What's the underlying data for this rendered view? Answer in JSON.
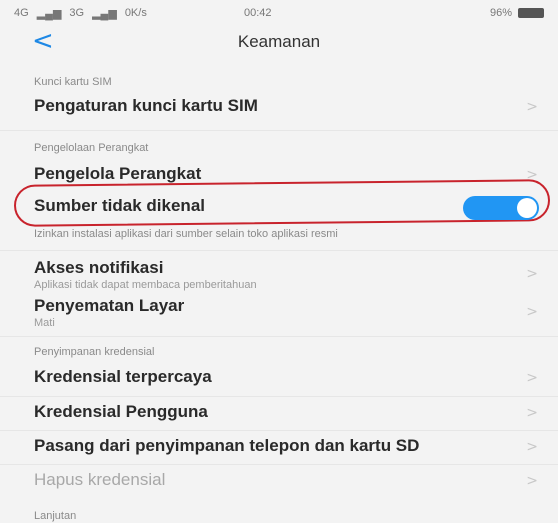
{
  "status": {
    "left": [
      "4G",
      "3G",
      "0K/s"
    ],
    "time": "00:42",
    "battery": "96%"
  },
  "header": {
    "title": "Keamanan"
  },
  "sections": {
    "sim": "Kunci kartu SIM",
    "device": "Pengelolaan Perangkat",
    "credential": "Penyimpanan kredensial",
    "advanced": "Lanjutan"
  },
  "rows": {
    "sim_lock": "Pengaturan kunci kartu SIM",
    "device_manager": "Pengelola Perangkat",
    "unknown_sources": "Sumber tidak dikenal",
    "unknown_sources_desc": "Izinkan instalasi aplikasi dari sumber selain toko aplikasi resmi",
    "notif_access": "Akses notifikasi",
    "notif_access_sub": "Aplikasi tidak dapat membaca pemberitahuan",
    "screen_pin": "Penyematan Layar",
    "screen_pin_sub": "Mati",
    "trusted_cred": "Kredensial terpercaya",
    "user_cred": "Kredensial Pengguna",
    "install_sd": "Pasang dari penyimpanan telepon dan kartu SD",
    "clear_cred": "Hapus kredensial"
  },
  "toggle": {
    "unknown_sources_on": true
  },
  "colors": {
    "accent": "#2196f3",
    "highlight": "#c8232c"
  }
}
